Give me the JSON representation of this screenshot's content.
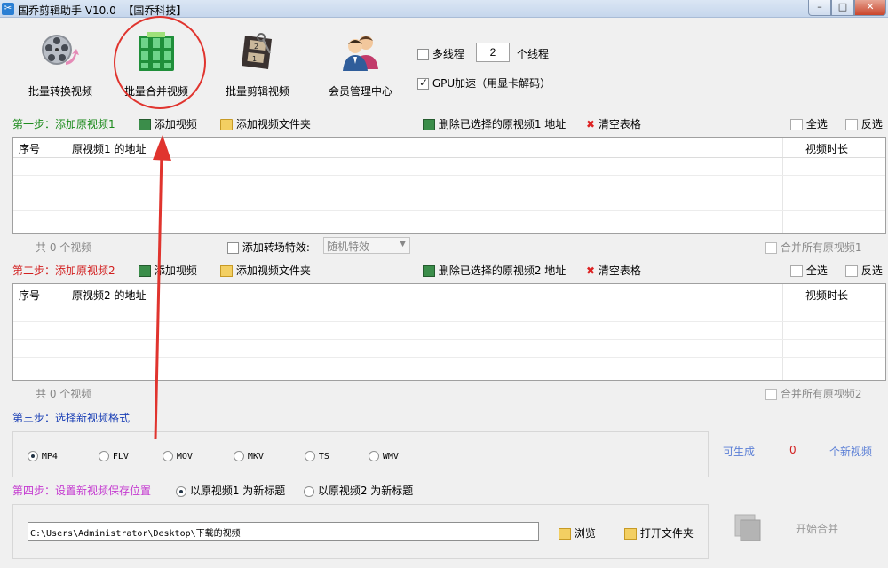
{
  "window": {
    "title": "国乔剪辑助手 V10.0  【国乔科技】",
    "app_icon_glyph": "✂"
  },
  "toolbar": {
    "items": [
      {
        "label": "批量转换视频",
        "icon": "film-reel-icon"
      },
      {
        "label": "批量合并视频",
        "icon": "film-grid-icon"
      },
      {
        "label": "批量剪辑视频",
        "icon": "film-strip-icon"
      },
      {
        "label": "会员管理中心",
        "icon": "users-icon"
      }
    ],
    "multithread_label": "多线程",
    "multithread_checked": false,
    "thread_count": "2",
    "thread_unit": "个线程",
    "gpu_label": "GPU加速（用显卡解码）",
    "gpu_checked": true
  },
  "step1": {
    "title": "第一步：添加原视频1",
    "title_color": "#1b8a1b",
    "add_video": "添加视频",
    "add_folder": "添加视频文件夹",
    "delete_selected": "删除已选择的原视频1 地址",
    "clear_table": "清空表格",
    "select_all": "全选",
    "invert_select": "反选",
    "table_headers": {
      "index": "序号",
      "path": "原视频1 的地址",
      "duration": "视频时长"
    },
    "count_text": "共 0 个视频",
    "transition_label": "添加转场特效:",
    "transition_value": "随机特效",
    "merge_all": "合并所有原视频1"
  },
  "step2": {
    "title": "第二步：添加原视频2",
    "title_color": "#d21f1f",
    "add_video": "添加视频",
    "add_folder": "添加视频文件夹",
    "delete_selected": "删除已选择的原视频2 地址",
    "clear_table": "清空表格",
    "select_all": "全选",
    "invert_select": "反选",
    "table_headers": {
      "index": "序号",
      "path": "原视频2 的地址",
      "duration": "视频时长"
    },
    "count_text": "共 0 个视频",
    "merge_all": "合并所有原视频2"
  },
  "step3": {
    "title": "第三步：选择新视频格式",
    "title_color": "#1a3fb5",
    "formats": [
      "MP4",
      "FLV",
      "MOV",
      "MKV",
      "TS",
      "WMV"
    ],
    "selected_format": "MP4",
    "can_generate_label": "可生成",
    "can_generate_count": "0",
    "new_videos_label": "个新视频"
  },
  "step4": {
    "title": "第四步：设置新视频保存位置",
    "title_color": "#c43bd0",
    "name_option_1": "以原视频1 为新标题",
    "name_option_2": "以原视频2 为新标题",
    "save_path": "C:\\Users\\Administrator\\Desktop\\下载的视频",
    "browse": "浏览",
    "open_folder": "打开文件夹",
    "start_merge": "开始合并"
  },
  "colors": {
    "annotation": "#e0342e",
    "link_blue": "#5b7fd6",
    "count_red": "#d21f1f"
  }
}
